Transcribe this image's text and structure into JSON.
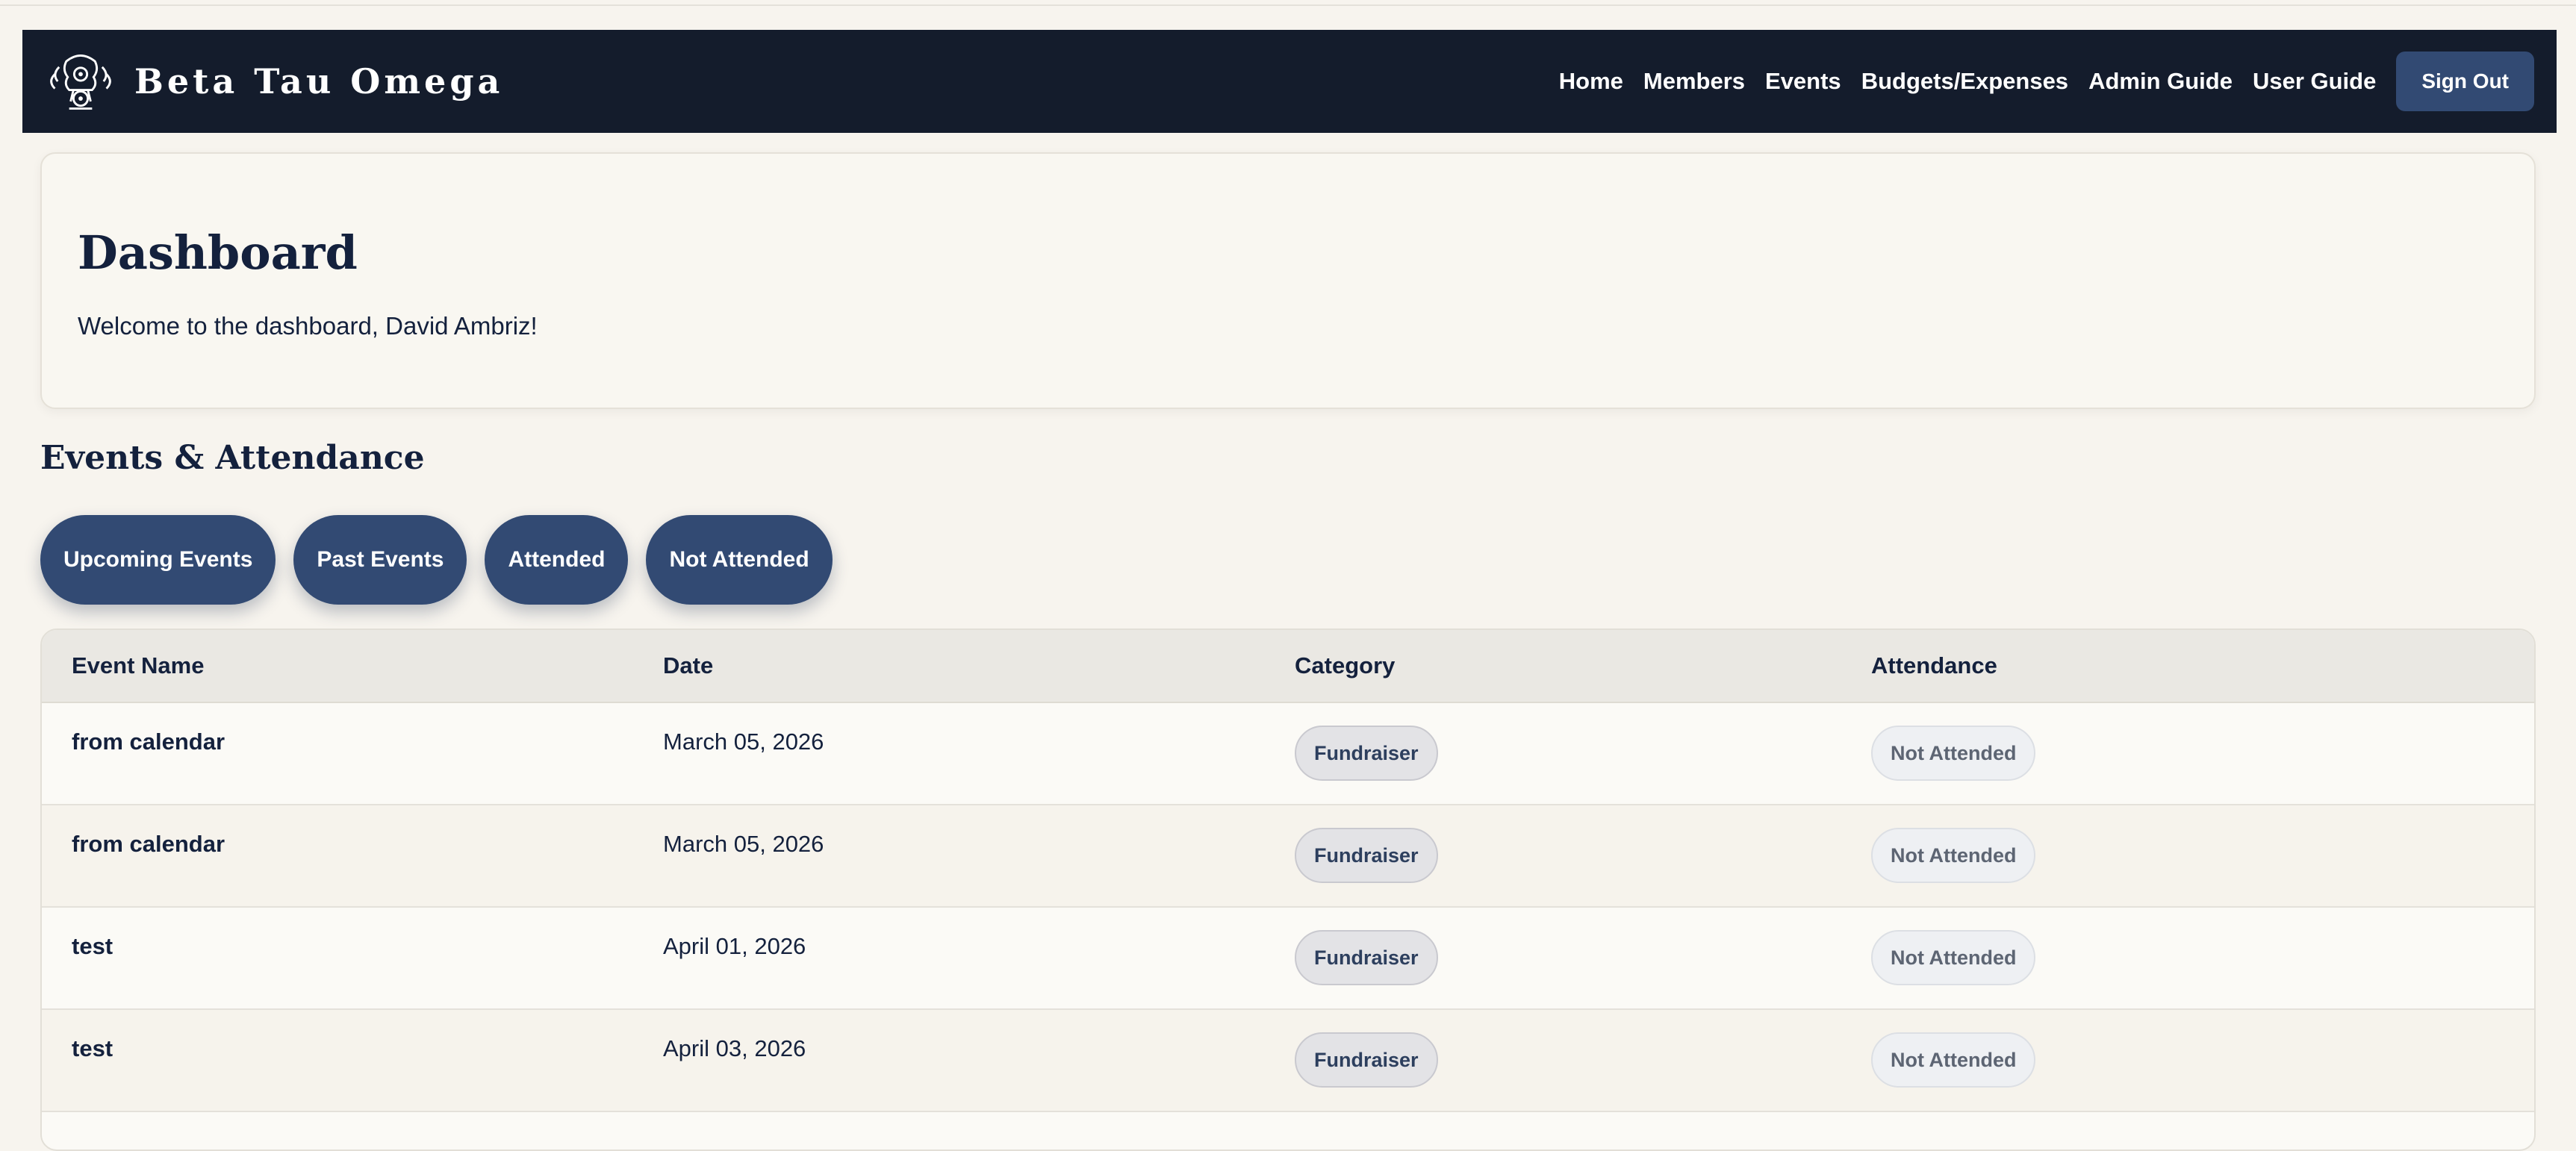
{
  "nav": {
    "brand": "Beta Tau Omega",
    "links": [
      "Home",
      "Members",
      "Events",
      "Budgets/Expenses",
      "Admin Guide",
      "User Guide"
    ],
    "sign_out": "Sign Out"
  },
  "dashboard": {
    "title": "Dashboard",
    "welcome": "Welcome to the dashboard, David Ambriz!"
  },
  "events": {
    "title": "Events & Attendance",
    "filters": [
      "Upcoming Events",
      "Past Events",
      "Attended",
      "Not Attended"
    ],
    "columns": [
      "Event Name",
      "Date",
      "Category",
      "Attendance"
    ],
    "rows": [
      {
        "name": "from calendar",
        "date": "March 05, 2026",
        "category": "Fundraiser",
        "attendance": "Not Attended"
      },
      {
        "name": "from calendar",
        "date": "March 05, 2026",
        "category": "Fundraiser",
        "attendance": "Not Attended"
      },
      {
        "name": "test",
        "date": "April 01, 2026",
        "category": "Fundraiser",
        "attendance": "Not Attended"
      },
      {
        "name": "test",
        "date": "April 03, 2026",
        "category": "Fundraiser",
        "attendance": "Not Attended"
      }
    ]
  },
  "colors": {
    "navbar": "#141c2c",
    "accent": "#324a73",
    "background": "#f7f4ee",
    "text": "#14213d"
  },
  "icons": {
    "brand_logo": "crest-logo-icon"
  }
}
